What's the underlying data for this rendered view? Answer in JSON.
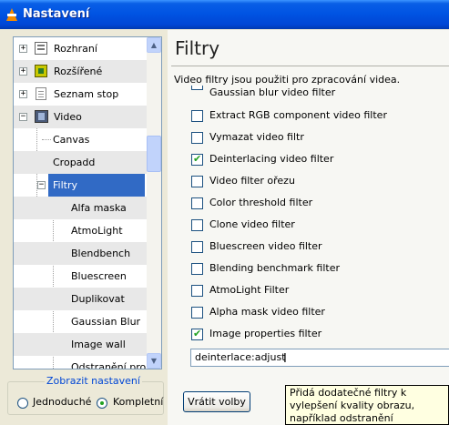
{
  "window": {
    "title": "Nastavení"
  },
  "tree": {
    "items": [
      {
        "label": "Rozhraní",
        "icon": "interface-icon"
      },
      {
        "label": "Rozšířené",
        "icon": "extended-icon"
      },
      {
        "label": "Seznam stop",
        "icon": "playlist-icon"
      },
      {
        "label": "Video",
        "icon": "video-film-icon"
      },
      {
        "label": "Canvas"
      },
      {
        "label": "Cropadd"
      },
      {
        "label": "Filtry",
        "selected": true
      },
      {
        "label": "Alfa maska"
      },
      {
        "label": "AtmoLight"
      },
      {
        "label": "Blendbench"
      },
      {
        "label": "Bluescreen"
      },
      {
        "label": "Duplikovat"
      },
      {
        "label": "Gaussian Blur"
      },
      {
        "label": "Image wall"
      },
      {
        "label": "Odstranění prokla"
      }
    ]
  },
  "mode": {
    "legend": "Zobrazit nastavení",
    "simple": "Jednoduché",
    "complete": "Kompletní",
    "selected": "complete"
  },
  "panel": {
    "title": "Filtry",
    "description": "Video filtry jsou použiti pro zpracování videa.",
    "filters": [
      {
        "label": "Gaussian blur video filter",
        "checked": false
      },
      {
        "label": "Extract RGB component video filter",
        "checked": false
      },
      {
        "label": "Vymazat video filtr",
        "checked": false
      },
      {
        "label": "Deinterlacing video filter",
        "checked": true
      },
      {
        "label": "Video filter ořezu",
        "checked": false
      },
      {
        "label": "Color threshold filter",
        "checked": false
      },
      {
        "label": "Clone video filter",
        "checked": false
      },
      {
        "label": "Bluescreen video filter",
        "checked": false
      },
      {
        "label": "Blending benchmark filter",
        "checked": false
      },
      {
        "label": "AtmoLight Filter",
        "checked": false
      },
      {
        "label": "Alpha mask video filter",
        "checked": false
      },
      {
        "label": "Image properties filter",
        "checked": true
      }
    ],
    "text_value": "deinterlace:adjust"
  },
  "buttons": {
    "reset": "Vrátit volby"
  },
  "tooltip": {
    "lines": [
      "Přidá dodatečné filtry k",
      "vylepšení kvality obrazu,",
      "například odstranění prokládání"
    ]
  },
  "colors": {
    "titlebar": "#0054e3",
    "selection": "#316ac5",
    "tooltip_bg": "#ffffe1",
    "check": "#21a121"
  }
}
